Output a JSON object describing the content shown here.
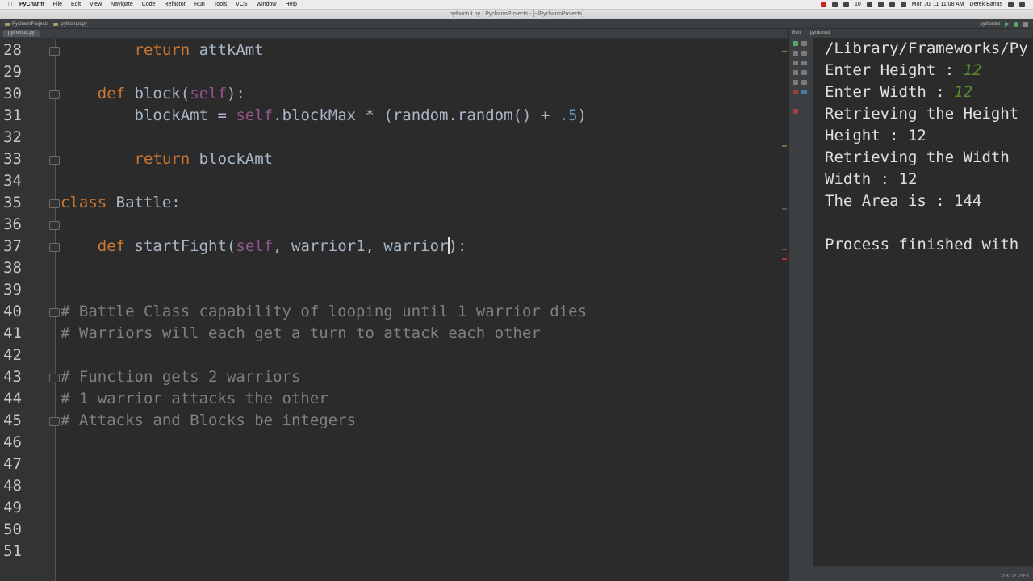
{
  "menubar": {
    "app_name": "PyCharm",
    "menus": [
      "File",
      "Edit",
      "View",
      "Navigate",
      "Code",
      "Refactor",
      "Run",
      "Tools",
      "VCS",
      "Window",
      "Help"
    ],
    "clock": "Mon Jul 11  11:08 AM",
    "user": "Derek Banas",
    "badge": "10"
  },
  "window": {
    "title": "pythontut.py - PycharmProjects - [~/PycharmProjects]"
  },
  "nav": {
    "project": "PycharmProjects",
    "file": "pythontut.py",
    "run_config": "pythontut"
  },
  "editor": {
    "tab_label": "pythontut.py",
    "line_numbers": [
      "28",
      "29",
      "30",
      "31",
      "32",
      "33",
      "34",
      "35",
      "36",
      "37",
      "38",
      "39",
      "40",
      "41",
      "42",
      "43",
      "44",
      "45",
      "46",
      "47",
      "48",
      "49",
      "50",
      "51"
    ],
    "line28": {
      "kw": "return",
      "rest": " attkAmt"
    },
    "line30": {
      "kw": "def",
      "name": "block",
      "open": "(",
      "self": "self",
      "close": "):"
    },
    "line31": {
      "lhs": "blockAmt = ",
      "self": "self",
      "mid": ".blockMax * (random.random() + ",
      "num": ".5",
      "end": ")"
    },
    "line33": {
      "kw": "return",
      "rest": " blockAmt"
    },
    "line35": {
      "kw": "class",
      "rest": " Battle:"
    },
    "line37": {
      "kw": "def",
      "name": "startFight",
      "open": "(",
      "self": "self",
      "args": ", warrior1, warrior",
      "close": "):"
    },
    "comments": [
      "# Battle Class capability of looping until 1 warrior dies",
      "# Warriors will each get a turn to attack each other",
      "# Function gets 2 warriors",
      "# 1 warrior attacks the other",
      "# Attacks and Blocks be integers"
    ]
  },
  "run_panel": {
    "header": "Run",
    "config": "pythontut",
    "console": {
      "path": "/Library/Frameworks/Py",
      "height_prompt": "Enter Height : ",
      "height_input": "12",
      "width_prompt": "Enter Width : ",
      "width_input": "12",
      "retr_height": "Retrieving the Height",
      "height_out": "Height : 12",
      "retr_width": "Retrieving the Width",
      "width_out": "Width : 12",
      "area": "The Area is : 144",
      "finished": "Process finished with"
    }
  },
  "status": {
    "text": "17:43  LF  UTF-8"
  },
  "colors": {
    "keyword": "#cc7832",
    "self": "#94558d",
    "number": "#6897bb",
    "comment": "#808080",
    "input": "#5b8d2e",
    "background": "#2b2b2b"
  }
}
